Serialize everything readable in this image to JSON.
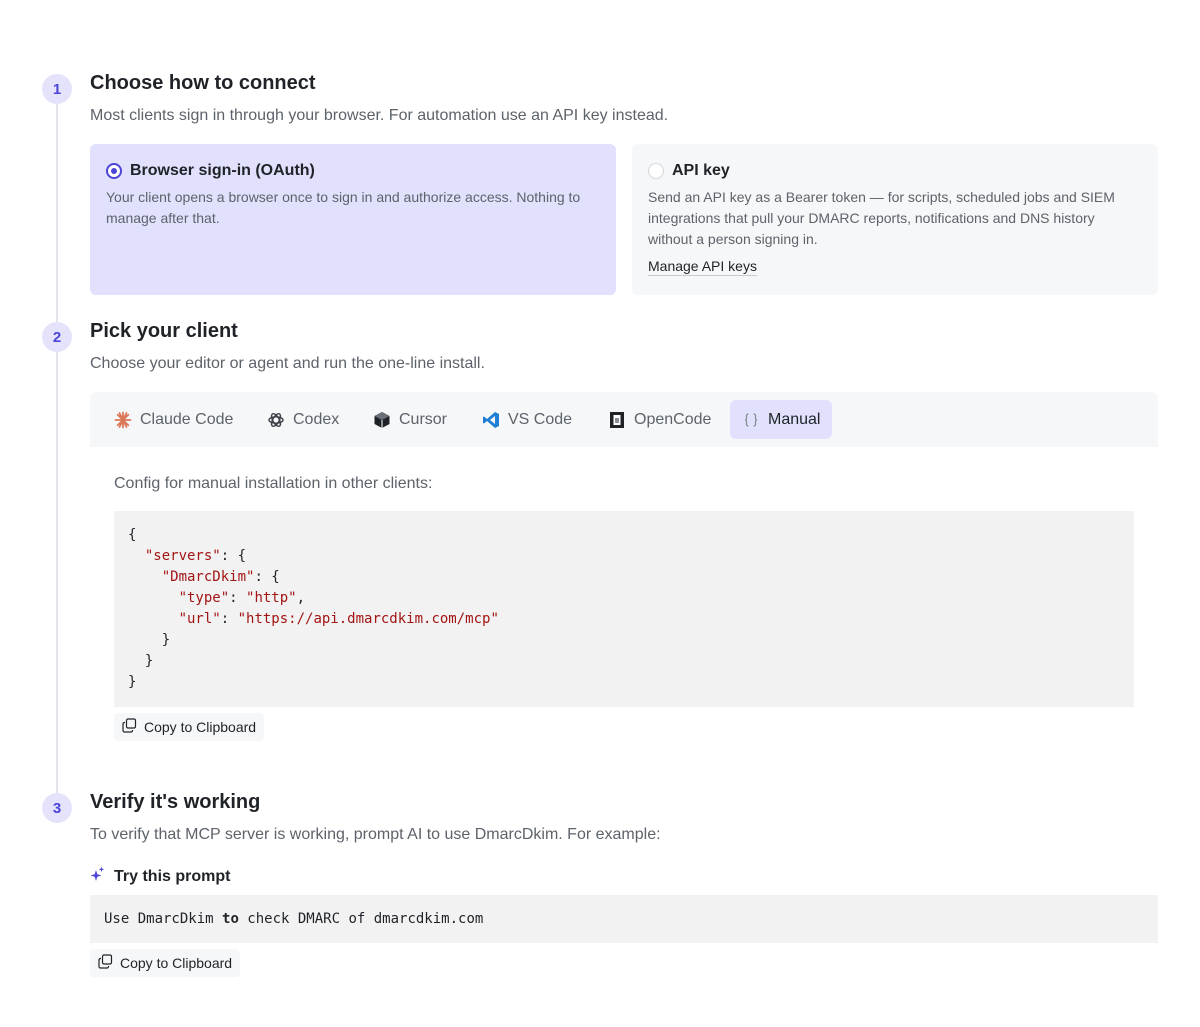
{
  "steps": [
    {
      "number": "1",
      "title": "Choose how to connect",
      "description": "Most clients sign in through your browser. For automation use an API key instead."
    },
    {
      "number": "2",
      "title": "Pick your client",
      "description": "Choose your editor or agent and run the one-line install."
    },
    {
      "number": "3",
      "title": "Verify it's working",
      "description": "To verify that MCP server is working, prompt AI to use DmarcDkim. For example:"
    }
  ],
  "connect_options": {
    "browser": {
      "title": "Browser sign-in (OAuth)",
      "description": "Your client opens a browser once to sign in and authorize access. Nothing to manage after that.",
      "selected": true
    },
    "api_key": {
      "title": "API key",
      "description": "Send an API key as a Bearer token — for scripts, scheduled jobs and SIEM integrations that pull your DMARC reports, notifications and DNS history without a person signing in.",
      "link_label": "Manage API keys",
      "selected": false
    }
  },
  "client_tabs": [
    {
      "label": "Claude Code",
      "icon": "claude-icon",
      "active": false
    },
    {
      "label": "Codex",
      "icon": "openai-icon",
      "active": false
    },
    {
      "label": "Cursor",
      "icon": "cursor-cube-icon",
      "active": false
    },
    {
      "label": "VS Code",
      "icon": "vscode-icon",
      "active": false
    },
    {
      "label": "OpenCode",
      "icon": "opencode-icon",
      "active": false
    },
    {
      "label": "Manual",
      "icon": "braces-icon",
      "active": true
    }
  ],
  "manual": {
    "label": "Config for manual installation in other clients:",
    "config": {
      "servers_key": "\"servers\"",
      "server_name": "\"DmarcDkim\"",
      "type_key": "\"type\"",
      "type_value": "\"http\"",
      "url_key": "\"url\"",
      "url_value": "\"https://api.dmarcdkim.com/mcp\""
    },
    "copy_label": "Copy to Clipboard"
  },
  "verify": {
    "prompt_heading": "Try this prompt",
    "prompt_parts": [
      "Use DmarcDkim ",
      "to",
      " check DMARC of dmarcdkim.com"
    ],
    "copy_label": "Copy to Clipboard"
  },
  "colors": {
    "accent": "#4b44d9",
    "selected_bg": "#e1e1fd",
    "badge_bg": "#e4e3fb",
    "code_string": "#a31515"
  }
}
